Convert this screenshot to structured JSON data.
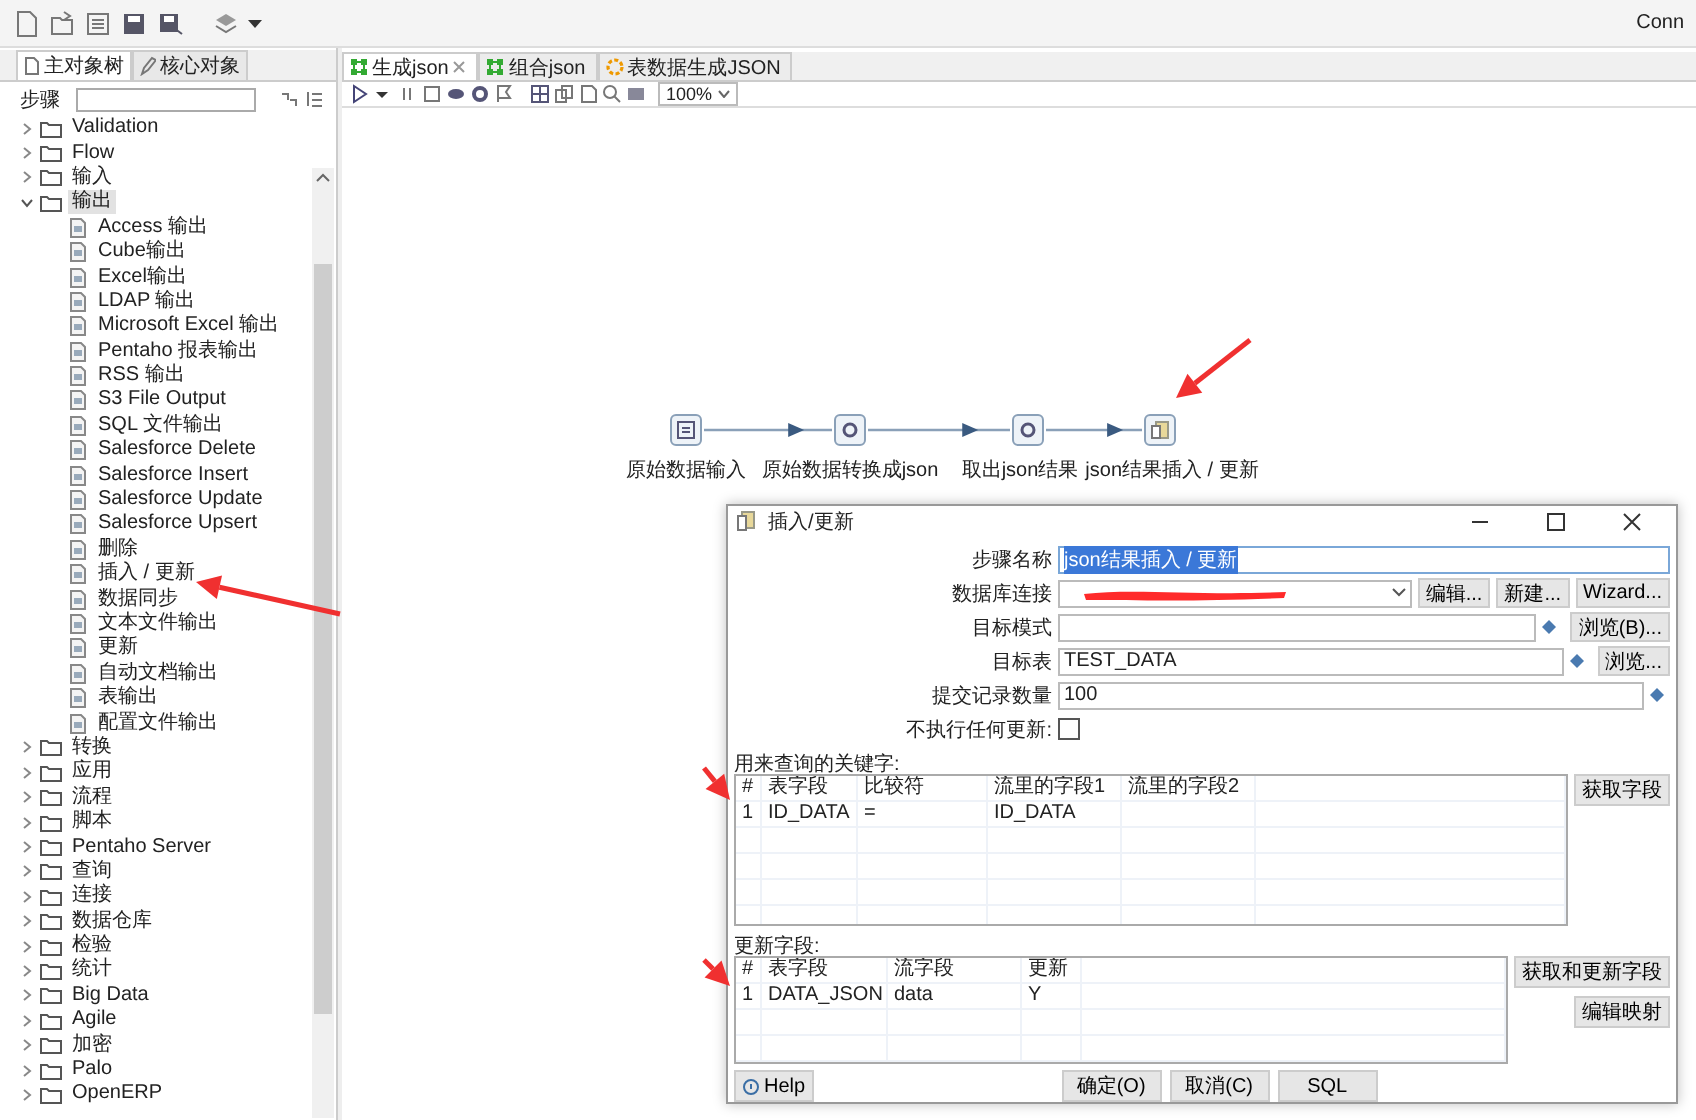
{
  "toolbar": {
    "right_text": "Conn"
  },
  "left_panel": {
    "tabs": [
      {
        "label": "主对象树",
        "selected": true
      },
      {
        "label": "核心对象",
        "selected": false
      }
    ],
    "search_label": "步骤",
    "tree": [
      {
        "label": "Validation",
        "expanded": false,
        "selected": false
      },
      {
        "label": "Flow",
        "expanded": false,
        "selected": false
      },
      {
        "label": "输入",
        "expanded": false,
        "selected": false
      },
      {
        "label": "输出",
        "expanded": true,
        "selected": true,
        "children": [
          {
            "label": "Access 输出",
            "selected": false
          },
          {
            "label": "Cube输出",
            "selected": false
          },
          {
            "label": "Excel输出",
            "selected": false
          },
          {
            "label": "LDAP 输出",
            "selected": false
          },
          {
            "label": "Microsoft Excel 输出",
            "selected": false
          },
          {
            "label": "Pentaho 报表输出",
            "selected": false
          },
          {
            "label": "RSS 输出",
            "selected": false
          },
          {
            "label": "S3 File Output",
            "selected": false
          },
          {
            "label": "SQL 文件输出",
            "selected": false
          },
          {
            "label": "Salesforce Delete",
            "selected": false
          },
          {
            "label": "Salesforce Insert",
            "selected": false
          },
          {
            "label": "Salesforce Update",
            "selected": false
          },
          {
            "label": "Salesforce Upsert",
            "selected": false
          },
          {
            "label": "删除",
            "selected": false
          },
          {
            "label": "插入 / 更新",
            "selected": false
          },
          {
            "label": "数据同步",
            "selected": false
          },
          {
            "label": "文本文件输出",
            "selected": false
          },
          {
            "label": "更新",
            "selected": false
          },
          {
            "label": "自动文档输出",
            "selected": false
          },
          {
            "label": "表输出",
            "selected": false
          },
          {
            "label": "配置文件输出",
            "selected": false
          }
        ]
      },
      {
        "label": "转换",
        "expanded": false,
        "selected": false
      },
      {
        "label": "应用",
        "expanded": false,
        "selected": false
      },
      {
        "label": "流程",
        "expanded": false,
        "selected": false
      },
      {
        "label": "脚本",
        "expanded": false,
        "selected": false
      },
      {
        "label": "Pentaho Server",
        "expanded": false,
        "selected": false
      },
      {
        "label": "查询",
        "expanded": false,
        "selected": false
      },
      {
        "label": "连接",
        "expanded": false,
        "selected": false
      },
      {
        "label": "数据仓库",
        "expanded": false,
        "selected": false
      },
      {
        "label": "检验",
        "expanded": false,
        "selected": false
      },
      {
        "label": "统计",
        "expanded": false,
        "selected": false
      },
      {
        "label": "Big Data",
        "expanded": false,
        "selected": false
      },
      {
        "label": "Agile",
        "expanded": false,
        "selected": false
      },
      {
        "label": "加密",
        "expanded": false,
        "selected": false
      },
      {
        "label": "Palo",
        "expanded": false,
        "selected": false
      },
      {
        "label": "OpenERP",
        "expanded": false,
        "selected": false
      }
    ]
  },
  "editor_tabs": [
    {
      "label": "生成json",
      "kind": "transformation",
      "selected": true
    },
    {
      "label": "组合json",
      "kind": "transformation",
      "selected": false
    },
    {
      "label": "表数据生成JSON",
      "kind": "job",
      "selected": false
    }
  ],
  "zoom": "100%",
  "canvas": {
    "steps": [
      {
        "label": "原始数据输入"
      },
      {
        "label": "原始数据转换成json"
      },
      {
        "label": "取出json结果"
      },
      {
        "label": "json结果插入 / 更新"
      }
    ]
  },
  "dialog": {
    "title": "插入/更新",
    "fields": [
      {
        "label": "步骤名称",
        "kind": "text",
        "value": "json结果插入 / 更新",
        "selected": true
      },
      {
        "label": "数据库连接",
        "kind": "select",
        "redacted": true,
        "buttons": [
          "编辑...",
          "新建...",
          "Wizard..."
        ]
      },
      {
        "label": "目标模式",
        "kind": "text",
        "variable": true,
        "buttons": [
          "浏览(B)..."
        ]
      },
      {
        "label": "目标表",
        "kind": "text",
        "value": "TEST_DATA",
        "variable": true,
        "buttons": [
          "浏览..."
        ]
      },
      {
        "label": "提交记录数量",
        "kind": "text",
        "value": "100",
        "variable": true
      },
      {
        "label": "不执行任何更新:",
        "kind": "checkbox",
        "checked": false
      }
    ],
    "key_section": {
      "label": "用来查询的关键字:",
      "columns": [
        "#",
        "表字段",
        "比较符",
        "流里的字段1",
        "流里的字段2"
      ],
      "rows": [
        [
          "1",
          "ID_DATA",
          "=",
          "ID_DATA"
        ]
      ],
      "button": "获取字段"
    },
    "update_section": {
      "label": "更新字段:",
      "columns": [
        "#",
        "表字段",
        "流字段",
        "更新"
      ],
      "rows": [
        [
          "1",
          "DATA_JSON",
          "data",
          "Y"
        ]
      ],
      "buttons": [
        "获取和更新字段",
        "编辑映射"
      ]
    },
    "footer": {
      "help": "Help",
      "buttons": [
        "确定(O)",
        "取消(C)",
        "SQL"
      ]
    }
  }
}
